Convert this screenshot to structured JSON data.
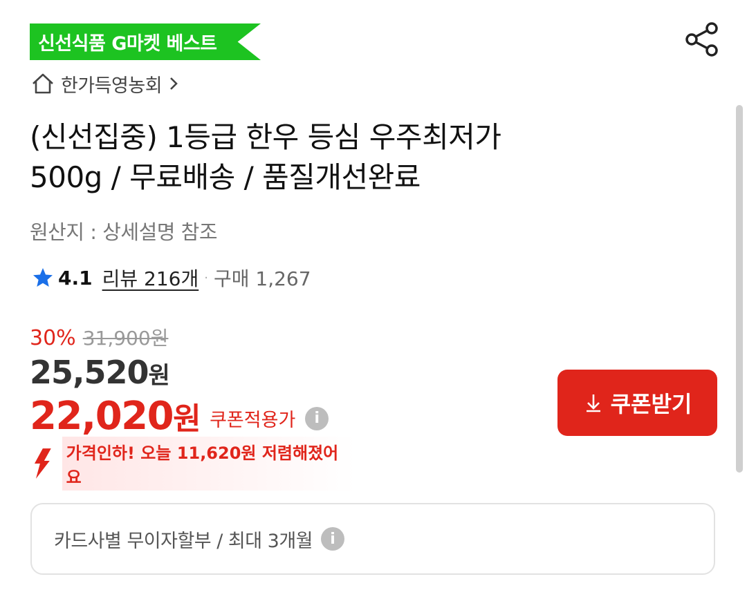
{
  "badge": {
    "label": "신선식품 G마켓 베스트"
  },
  "seller": {
    "name": "한가득영농회"
  },
  "product": {
    "title_line1": "(신선집중) 1등급 한우 등심 우주최저가",
    "title_line2": "500g / 무료배송 / 품질개선완료",
    "origin": "원산지 : 상세설명 참조"
  },
  "rating": {
    "score": "4.1",
    "review_link": "리뷰 216개",
    "separator": "·",
    "purchases": "구매 1,267"
  },
  "price": {
    "discount_pct": "30%",
    "original": "31,900원",
    "sale_amount": "25,520",
    "sale_unit": "원",
    "coupon_amount": "22,020",
    "coupon_unit": "원",
    "coupon_label": "쿠폰적용가"
  },
  "coupon_button": {
    "label": "쿠폰받기"
  },
  "price_drop": {
    "message": "가격인하! 오늘 11,620원 저렴해졌어요"
  },
  "installment": {
    "text": "카드사별 무이자할부 / 최대 3개월"
  },
  "info_icon": {
    "glyph": "i"
  },
  "colors": {
    "accent_red": "#e0251b",
    "badge_green": "#1dc321",
    "star_blue": "#1a6fe8"
  }
}
